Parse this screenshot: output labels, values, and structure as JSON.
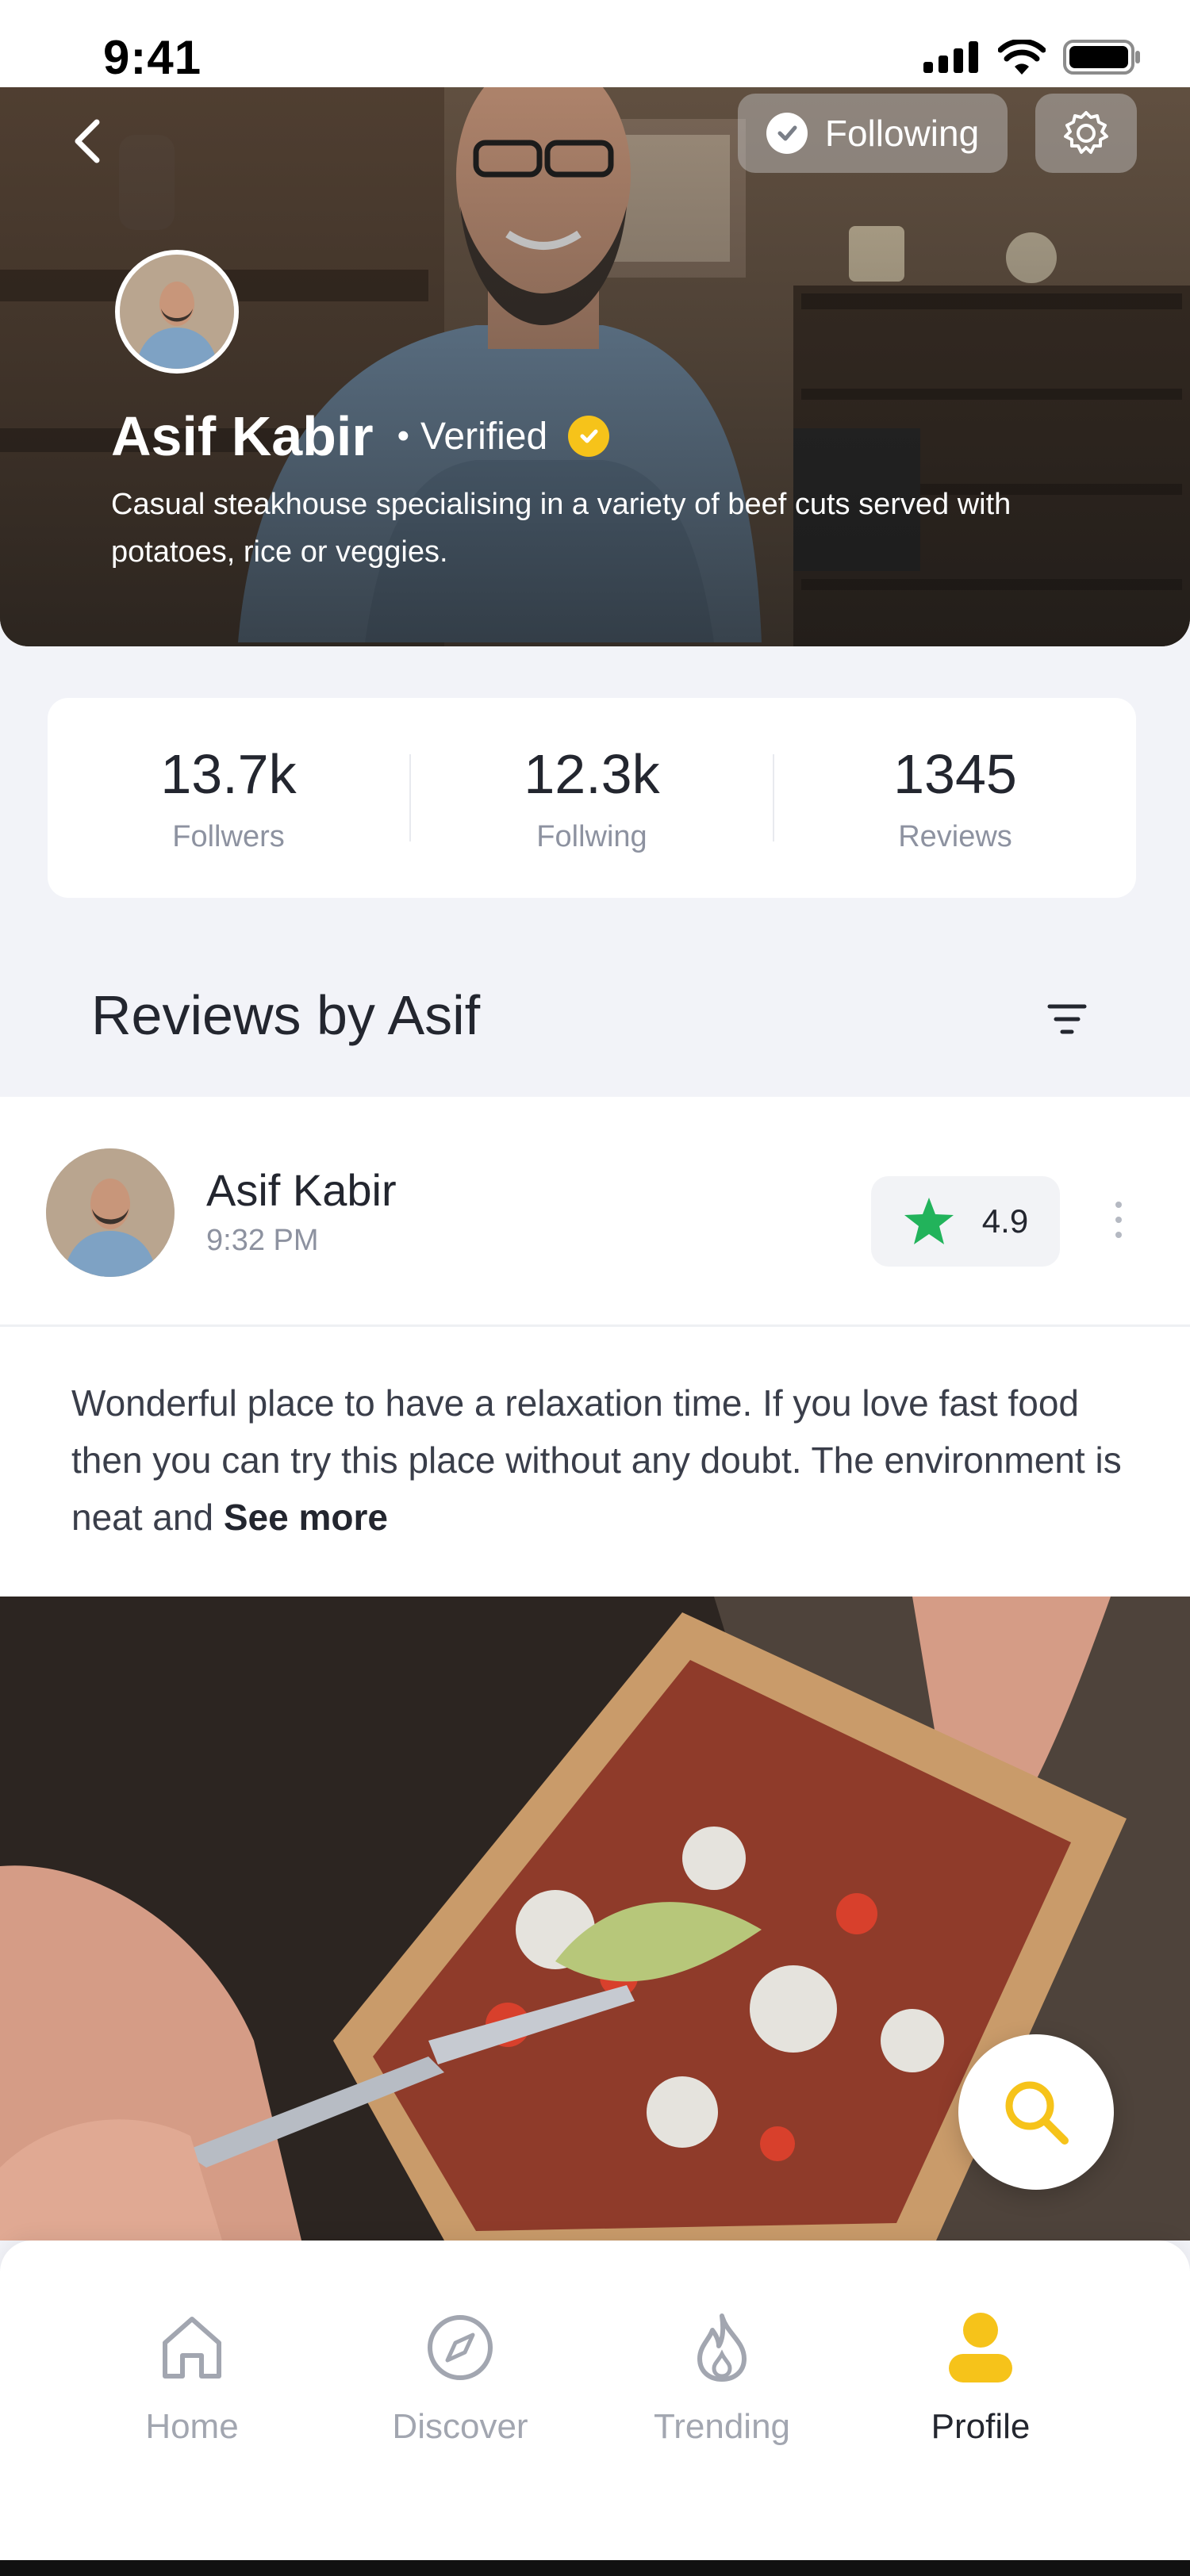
{
  "status_bar": {
    "time": "9:41"
  },
  "header": {
    "following_label": "Following",
    "name": "Asif Kabir",
    "verified_separator": "•",
    "verified_label": "Verified",
    "bio": "Casual steakhouse specialising in a variety of beef cuts served with potatoes, rice or veggies."
  },
  "stats": [
    {
      "value": "13.7k",
      "label": "Follwers"
    },
    {
      "value": "12.3k",
      "label": "Follwing"
    },
    {
      "value": "1345",
      "label": "Reviews"
    }
  ],
  "reviews_section": {
    "title": "Reviews by Asif"
  },
  "review": {
    "author": "Asif Kabir",
    "time": "9:32 PM",
    "rating": "4.9",
    "text": "Wonderful place to have a relaxation time. If you love fast food then you can try this place without any doubt. The environment is neat and ",
    "see_more": "See more"
  },
  "bottom_nav": [
    {
      "label": "Home",
      "icon": "home-icon",
      "active": false
    },
    {
      "label": "Discover",
      "icon": "compass-icon",
      "active": false
    },
    {
      "label": "Trending",
      "icon": "flame-icon",
      "active": false
    },
    {
      "label": "Profile",
      "icon": "user-icon",
      "active": true
    }
  ],
  "colors": {
    "accent": "#f6c31a",
    "rating_star": "#22b35b",
    "text_primary": "#23262f",
    "text_secondary": "#8d92a0",
    "background": "#f2f3f8"
  }
}
